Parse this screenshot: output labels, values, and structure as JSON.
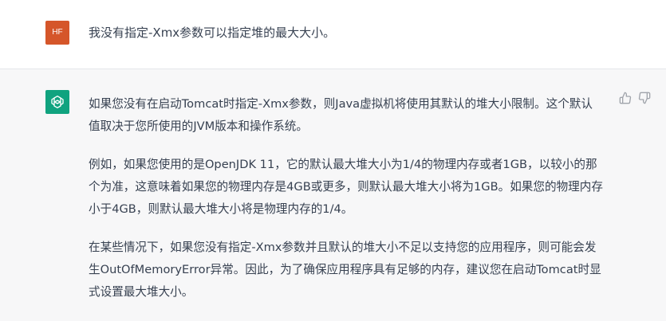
{
  "user_message": {
    "avatar_initials": "HF",
    "avatar_color": "#d5562a",
    "text": "我没有指定-Xmx参数可以指定堆的最大大小。"
  },
  "assistant_message": {
    "avatar_icon": "openai-logo-icon",
    "avatar_color": "#10a37f",
    "paragraphs": [
      "如果您没有在启动Tomcat时指定-Xmx参数，则Java虚拟机将使用其默认的堆大小限制。这个默认值取决于您所使用的JVM版本和操作系统。",
      "例如，如果您使用的是OpenJDK 11，它的默认最大堆大小为1/4的物理内存或者1GB，以较小的那个为准，这意味着如果您的物理内存是4GB或更多，则默认最大堆大小将为1GB。如果您的物理内存小于4GB，则默认最大堆大小将是物理内存的1/4。",
      "在某些情况下，如果您没有指定-Xmx参数并且默认的堆大小不足以支持您的应用程序，则可能会发生OutOfMemoryError异常。因此，为了确保应用程序具有足够的内存，建议您在启动Tomcat时显式设置最大堆大小。"
    ],
    "feedback": {
      "thumbs_up_icon": "thumbs-up-icon",
      "thumbs_down_icon": "thumbs-down-icon"
    }
  }
}
